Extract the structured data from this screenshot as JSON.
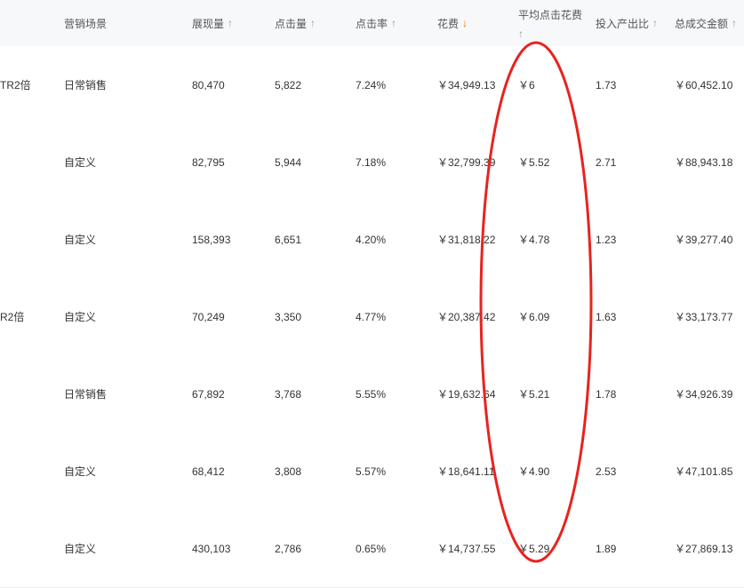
{
  "header": {
    "scene": "营销场景",
    "impressions": "展现量",
    "clicks": "点击量",
    "ctr": "点击率",
    "cost": "花费",
    "avg_cpc": "平均点击花费",
    "roi": "投入产出比",
    "gmv": "总成交金额",
    "sort_arrow": "↑",
    "sort_arrow_active": "↓"
  },
  "rows": [
    {
      "name": "TR2倍",
      "scene": "日常销售",
      "impressions": "80,470",
      "clicks": "5,822",
      "ctr": "7.24%",
      "cost": "￥34,949.13",
      "avg_cpc": "￥6",
      "roi": "1.73",
      "gmv": "￥60,452.10"
    },
    {
      "name": "",
      "scene": "自定义",
      "impressions": "82,795",
      "clicks": "5,944",
      "ctr": "7.18%",
      "cost": "￥32,799.39",
      "avg_cpc": "￥5.52",
      "roi": "2.71",
      "gmv": "￥88,943.18"
    },
    {
      "name": "",
      "scene": "自定义",
      "impressions": "158,393",
      "clicks": "6,651",
      "ctr": "4.20%",
      "cost": "￥31,818.22",
      "avg_cpc": "￥4.78",
      "roi": "1.23",
      "gmv": "￥39,277.40"
    },
    {
      "name": "R2倍",
      "scene": "自定义",
      "impressions": "70,249",
      "clicks": "3,350",
      "ctr": "4.77%",
      "cost": "￥20,387.42",
      "avg_cpc": "￥6.09",
      "roi": "1.63",
      "gmv": "￥33,173.77"
    },
    {
      "name": "",
      "scene": "日常销售",
      "impressions": "67,892",
      "clicks": "3,768",
      "ctr": "5.55%",
      "cost": "￥19,632.64",
      "avg_cpc": "￥5.21",
      "roi": "1.78",
      "gmv": "￥34,926.39"
    },
    {
      "name": "",
      "scene": "自定义",
      "impressions": "68,412",
      "clicks": "3,808",
      "ctr": "5.57%",
      "cost": "￥18,641.11",
      "avg_cpc": "￥4.90",
      "roi": "2.53",
      "gmv": "￥47,101.85"
    },
    {
      "name": "",
      "scene": "自定义",
      "impressions": "430,103",
      "clicks": "2,786",
      "ctr": "0.65%",
      "cost": "￥14,737.55",
      "avg_cpc": "￥5.29",
      "roi": "1.89",
      "gmv": "￥27,869.13"
    }
  ],
  "annotation": {
    "color": "#e8231f",
    "shape": "ellipse"
  }
}
